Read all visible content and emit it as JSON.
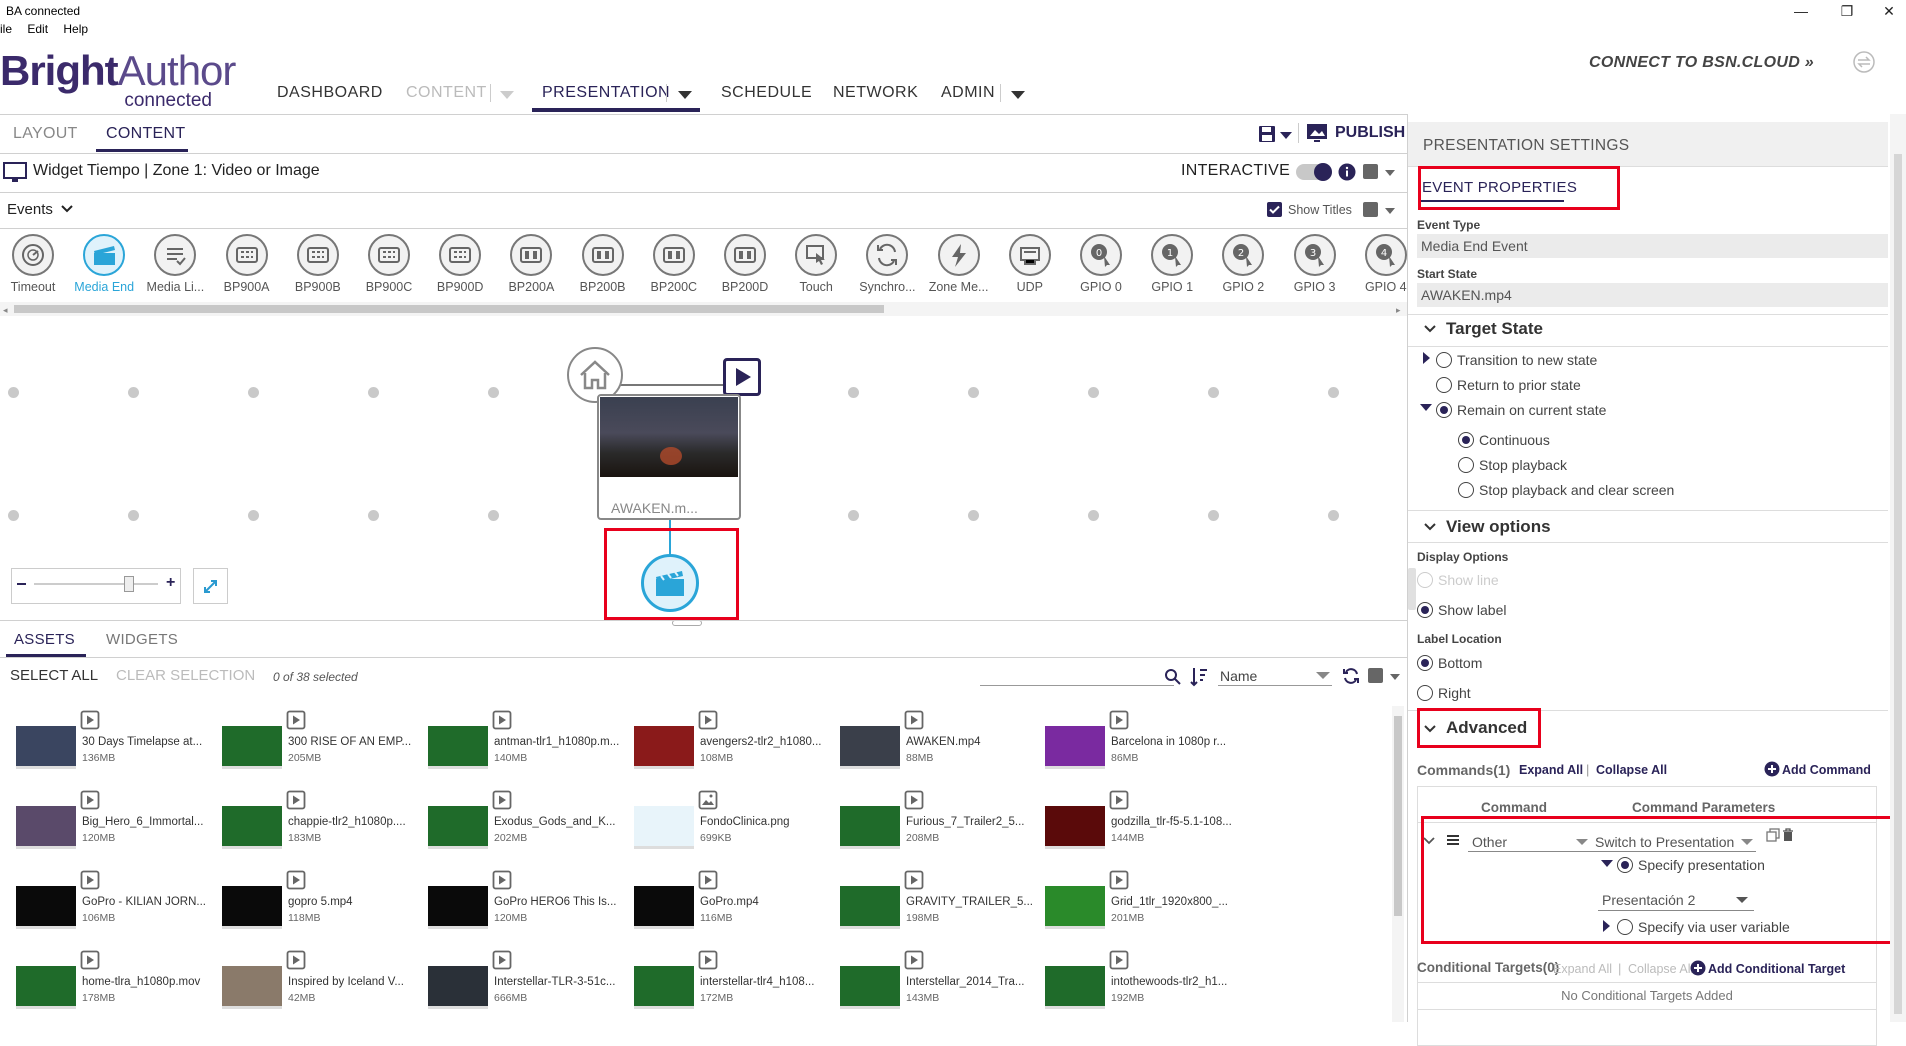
{
  "window": {
    "title": "BA connected",
    "minimize": "—",
    "restore": "❐",
    "close": "✕"
  },
  "menu": [
    "ile",
    "Edit",
    "Help"
  ],
  "logo": {
    "bright": "Bright",
    "author": "Author",
    "connected": "connected"
  },
  "nav": {
    "dashboard": "DASHBOARD",
    "content": "CONTENT",
    "presentation": "PRESENTATION",
    "schedule": "SCHEDULE",
    "network": "NETWORK",
    "admin": "ADMIN"
  },
  "bsn": "CONNECT TO BSN.CLOUD »",
  "tabs": {
    "layout": "LAYOUT",
    "content": "CONTENT",
    "publish": "PUBLISH"
  },
  "zone": {
    "title": "Widget Tiempo | Zone 1: Video or Image",
    "interactive": "INTERACTIVE"
  },
  "events_bar": {
    "label": "Events",
    "show_titles": "Show Titles"
  },
  "events": [
    {
      "label": "Timeout",
      "icon": "timeout-icon"
    },
    {
      "label": "Media End",
      "icon": "media-end-icon",
      "selected": true
    },
    {
      "label": "Media Li...",
      "icon": "media-list-icon"
    },
    {
      "label": "BP900A",
      "icon": "bp900-icon"
    },
    {
      "label": "BP900B",
      "icon": "bp900-icon"
    },
    {
      "label": "BP900C",
      "icon": "bp900-icon"
    },
    {
      "label": "BP900D",
      "icon": "bp900-icon"
    },
    {
      "label": "BP200A",
      "icon": "bp200-icon"
    },
    {
      "label": "BP200B",
      "icon": "bp200-icon"
    },
    {
      "label": "BP200C",
      "icon": "bp200-icon"
    },
    {
      "label": "BP200D",
      "icon": "bp200-icon"
    },
    {
      "label": "Touch",
      "icon": "touch-icon"
    },
    {
      "label": "Synchro...",
      "icon": "sync-icon"
    },
    {
      "label": "Zone Me...",
      "icon": "zone-message-icon"
    },
    {
      "label": "UDP",
      "icon": "udp-icon"
    },
    {
      "label": "GPIO 0",
      "icon": "gpio-icon",
      "num": "0"
    },
    {
      "label": "GPIO 1",
      "icon": "gpio-icon",
      "num": "1"
    },
    {
      "label": "GPIO 2",
      "icon": "gpio-icon",
      "num": "2"
    },
    {
      "label": "GPIO 3",
      "icon": "gpio-icon",
      "num": "3"
    },
    {
      "label": "GPIO 4",
      "icon": "gpio-icon",
      "num": "4"
    }
  ],
  "canvas": {
    "state_label": "AWAKEN.m..."
  },
  "assets_panel": {
    "tab_assets": "ASSETS",
    "tab_widgets": "WIDGETS",
    "select_all": "SELECT ALL",
    "clear_selection": "CLEAR SELECTION",
    "selected_count": "0 of 38 selected",
    "sort": "Name",
    "items": [
      {
        "name": "30 Days Timelapse at...",
        "size": "136MB",
        "thumb": "#3a4560",
        "type": "video"
      },
      {
        "name": "300 RISE OF AN EMP...",
        "size": "205MB",
        "thumb": "#1f6b2a",
        "type": "video"
      },
      {
        "name": "antman-tlr1_h1080p.m...",
        "size": "140MB",
        "thumb": "#1f6b2a",
        "type": "video"
      },
      {
        "name": "avengers2-tlr2_h1080...",
        "size": "108MB",
        "thumb": "#8a1a1a",
        "type": "video"
      },
      {
        "name": "AWAKEN.mp4",
        "size": "88MB",
        "thumb": "#3a3f4a",
        "type": "video"
      },
      {
        "name": "Barcelona in 1080p r...",
        "size": "86MB",
        "thumb": "#7a2aa0",
        "type": "video"
      },
      {
        "name": "Big_Hero_6_Immortal...",
        "size": "120MB",
        "thumb": "#5a4a6a",
        "type": "video"
      },
      {
        "name": "chappie-tlr2_h1080p....",
        "size": "183MB",
        "thumb": "#1f6b2a",
        "type": "video"
      },
      {
        "name": "Exodus_Gods_and_K...",
        "size": "202MB",
        "thumb": "#1f6b2a",
        "type": "video"
      },
      {
        "name": "FondoClinica.png",
        "size": "699KB",
        "thumb": "#e8f4fa",
        "type": "image"
      },
      {
        "name": "Furious_7_Trailer2_5...",
        "size": "208MB",
        "thumb": "#1f6b2a",
        "type": "video"
      },
      {
        "name": "godzilla_tlr-f5-5.1-108...",
        "size": "144MB",
        "thumb": "#5a0a0a",
        "type": "video"
      },
      {
        "name": "GoPro - KILIAN JORN...",
        "size": "106MB",
        "thumb": "#0a0a0a",
        "type": "video"
      },
      {
        "name": "gopro 5.mp4",
        "size": "118MB",
        "thumb": "#0a0a0a",
        "type": "video"
      },
      {
        "name": "GoPro HERO6 This Is...",
        "size": "120MB",
        "thumb": "#0a0a0a",
        "type": "video"
      },
      {
        "name": "GoPro.mp4",
        "size": "116MB",
        "thumb": "#0a0a0a",
        "type": "video"
      },
      {
        "name": "GRAVITY_TRAILER_5...",
        "size": "198MB",
        "thumb": "#1f6b2a",
        "type": "video"
      },
      {
        "name": "Grid_1tlr_1920x800_...",
        "size": "201MB",
        "thumb": "#2a8a2a",
        "type": "video"
      },
      {
        "name": "home-tlra_h1080p.mov",
        "size": "178MB",
        "thumb": "#1f6b2a",
        "type": "video"
      },
      {
        "name": "Inspired by Iceland V...",
        "size": "42MB",
        "thumb": "#8a7a6a",
        "type": "video"
      },
      {
        "name": "Interstellar-TLR-3-51c...",
        "size": "666MB",
        "thumb": "#2a3038",
        "type": "video"
      },
      {
        "name": "interstellar-tlr4_h108...",
        "size": "172MB",
        "thumb": "#1f6b2a",
        "type": "video"
      },
      {
        "name": "Interstellar_2014_Tra...",
        "size": "143MB",
        "thumb": "#1f6b2a",
        "type": "video"
      },
      {
        "name": "intothewoods-tlr2_h1...",
        "size": "192MB",
        "thumb": "#1f6b2a",
        "type": "video"
      }
    ]
  },
  "right_panel": {
    "header": "PRESENTATION SETTINGS",
    "event_properties": "EVENT PROPERTIES",
    "event_type_label": "Event Type",
    "event_type": "Media End Event",
    "start_state_label": "Start State",
    "start_state": "AWAKEN.mp4",
    "target_state": {
      "title": "Target State",
      "transition": "Transition to new state",
      "return": "Return to prior state",
      "remain": "Remain on current state",
      "continuous": "Continuous",
      "stop": "Stop playback",
      "stop_clear": "Stop playback and clear screen"
    },
    "view_options": {
      "title": "View options",
      "display_options": "Display Options",
      "show_line": "Show line",
      "show_label": "Show label",
      "label_location": "Label Location",
      "bottom": "Bottom",
      "right": "Right"
    },
    "advanced": {
      "title": "Advanced",
      "commands": "Commands(1)",
      "expand_all": "Expand All",
      "collapse_all": "Collapse All",
      "add_command": "Add Command",
      "col_command": "Command",
      "col_params": "Command Parameters",
      "command_value": "Other",
      "param_value": "Switch to Presentation",
      "specify_presentation": "Specify presentation",
      "presentation_value": "Presentación 2",
      "specify_variable": "Specify via user variable",
      "conditional_targets": "Conditional Targets(0)",
      "add_conditional": "Add Conditional Target",
      "no_conditional": "No Conditional Targets Added"
    }
  }
}
